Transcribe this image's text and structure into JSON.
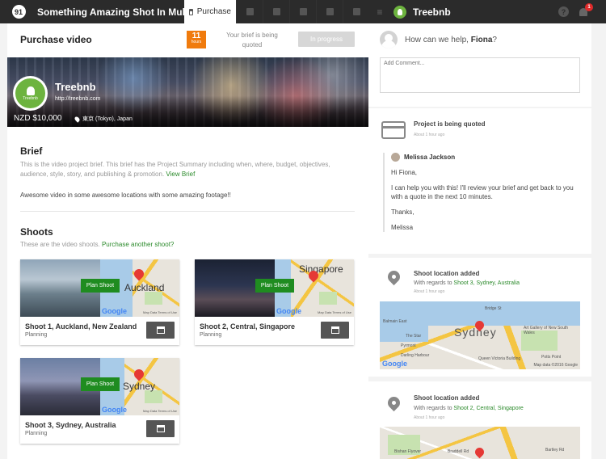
{
  "topbar": {
    "logo_text": "91",
    "project_title": "Something Amazing Shot In Multi...",
    "purchase_tab": "Purchase",
    "brand_name": "Treebnb",
    "help_label": "?",
    "notification_count": "1"
  },
  "purchase": {
    "title": "Purchase video",
    "hours_value": "11",
    "hours_unit": "hours",
    "brief_status": "Your brief is being quoted",
    "progress_label": "In progress"
  },
  "company": {
    "logo_name": "Treebnb",
    "name": "Treebnb",
    "url": "http://treebnb.com",
    "price": "NZD $10,000",
    "location": "東京 (Tokyo), Japan"
  },
  "brief": {
    "title": "Brief",
    "description": "This is the video project brief. This brief has the Project Summary including when, where, budget, objectives, audience, style, story, and publishing & promotion.",
    "view_link": "View Brief",
    "note": "Awesome video in some awesome locations with some amazing footage!!"
  },
  "shoots": {
    "title": "Shoots",
    "description": "These are the video shoots.",
    "purchase_link": "Purchase another shoot?",
    "items": [
      {
        "name": "Shoot 1, Auckland, New Zealand",
        "status": "Planning",
        "plan_label": "Plan Shoot",
        "map_city": "Auckland",
        "map_google": "Google",
        "map_terms": "Map Data  Terms of Use"
      },
      {
        "name": "Shoot 2, Central, Singapore",
        "status": "Planning",
        "plan_label": "Plan Shoot",
        "map_city": "Singapore",
        "map_google": "Google",
        "map_terms": "Map Data  Terms of Use"
      },
      {
        "name": "Shoot 3, Sydney, Australia",
        "status": "Planning",
        "plan_label": "Plan Shoot",
        "map_city": "Sydney",
        "map_google": "Google",
        "map_terms": "Map Data  Terms of Use"
      }
    ]
  },
  "activity": {
    "help_prefix": "How can we help,",
    "help_name": "Fiona",
    "help_suffix": "?",
    "comment_placeholder": "Add Comment...",
    "quoted_title": "Project is being quoted",
    "quoted_time": "About 1 hour ago",
    "message": {
      "author": "Melissa Jackson",
      "greeting": "Hi Fiona,",
      "body": "I can help you with this! I'll review your brief and get back to you with a quote in the next 10 minutes.",
      "thanks": "Thanks,",
      "signature": "Melissa"
    },
    "location_events": [
      {
        "title": "Shoot location added",
        "regards_prefix": "With regards to",
        "regards_link": "Shoot 3, Sydney, Australia",
        "time": "About 1 hour ago",
        "map_city": "Sydney",
        "map_google": "Google",
        "map_terms": "Map data ©2016 Google"
      },
      {
        "title": "Shoot location added",
        "regards_prefix": "With regards to",
        "regards_link": "Shoot 2, Central, Singapore",
        "time": "About 1 hour ago"
      }
    ],
    "sydney_map_labels": {
      "l1": "Bridge St",
      "l2": "The Star",
      "l3": "Pyrmont",
      "l4": "Darling Harbour",
      "l5": "Art Gallery of New South Wales",
      "l6": "Queen Victoria Building",
      "l7": "Potts Point",
      "l8": "Balmain East"
    },
    "singapore_map_labels": {
      "l1": "Bishan Flyover",
      "l2": "Braddell Rd",
      "l3": "Bartley Rd"
    }
  },
  "colors": {
    "accent_green": "#1f8c20",
    "link_green": "#2b8a2b",
    "hours_orange": "#f07b0d",
    "topbar": "#2b2b2b"
  }
}
